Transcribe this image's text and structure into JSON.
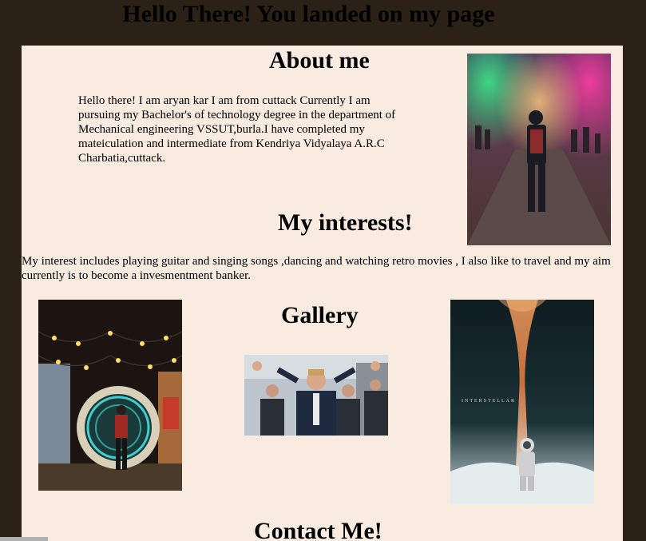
{
  "page": {
    "title": "Hello There! You landed on my page"
  },
  "about": {
    "heading": "About me",
    "text": "Hello there! I am aryan kar I am from cuttack Currently I am pursuing my Bachelor's of technology degree in the department of Mechanical engineering VSSUT,burla.I have completed my mateiculation and intermediate from Kendriya Vidyalaya A.R.C Charbatia,cuttack."
  },
  "interests": {
    "heading": "My interests!",
    "text": "My interest includes playing guitar and singing songs ,dancing and watching retro movies , I also like to travel and my aim currently is to become a invesmentment banker."
  },
  "gallery": {
    "heading": "Gallery",
    "poster_text": "INTERSTELLAR"
  },
  "contact": {
    "heading": "Contact Me!"
  },
  "colors": {
    "page_background": "#2b2117",
    "panel_background": "#f9ebe0",
    "text": "#000000"
  }
}
